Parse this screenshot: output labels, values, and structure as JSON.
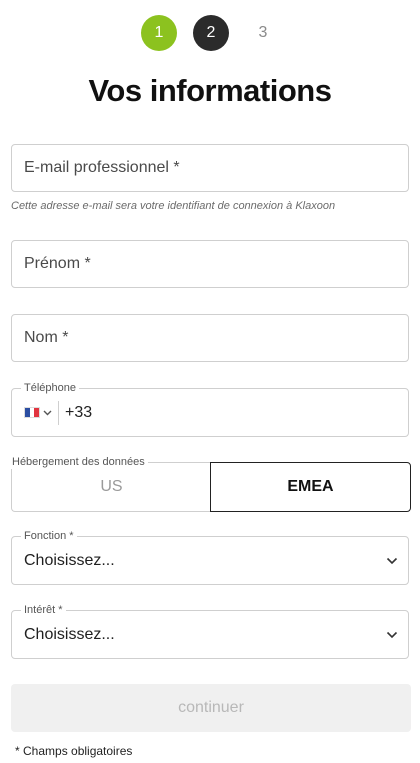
{
  "stepper": {
    "steps": [
      {
        "label": "1",
        "state": "completed",
        "color": "#8cc21f"
      },
      {
        "label": "2",
        "state": "current",
        "color": "#2b2b2b"
      },
      {
        "label": "3",
        "state": "upcoming",
        "color": "#8a8a8a"
      }
    ]
  },
  "page": {
    "title": "Vos informations"
  },
  "form": {
    "email": {
      "placeholder": "E-mail professionnel *",
      "value": "",
      "hint": "Cette adresse e-mail sera votre identifiant de connexion à Klaxoon"
    },
    "first_name": {
      "placeholder": "Prénom *",
      "value": ""
    },
    "last_name": {
      "placeholder": "Nom *",
      "value": ""
    },
    "phone": {
      "label": "Téléphone",
      "country_flag_icon": "france-flag-icon",
      "dial_code": "+33",
      "value": ""
    },
    "hosting": {
      "label": "Hébergement des données",
      "options": [
        "US",
        "EMEA"
      ],
      "selected": "EMEA"
    },
    "function": {
      "label": "Fonction *",
      "value": "Choisissez..."
    },
    "interest": {
      "label": "Intérêt *",
      "value": "Choisissez..."
    },
    "submit": {
      "label": "continuer",
      "enabled": false
    },
    "required_note": "* Champs obligatoires"
  },
  "colors": {
    "accent_green": "#8cc21f",
    "dark": "#2b2b2b",
    "border": "#cfcfcf",
    "disabled_bg": "#f0f0f0",
    "disabled_text": "#b8b8b8"
  }
}
